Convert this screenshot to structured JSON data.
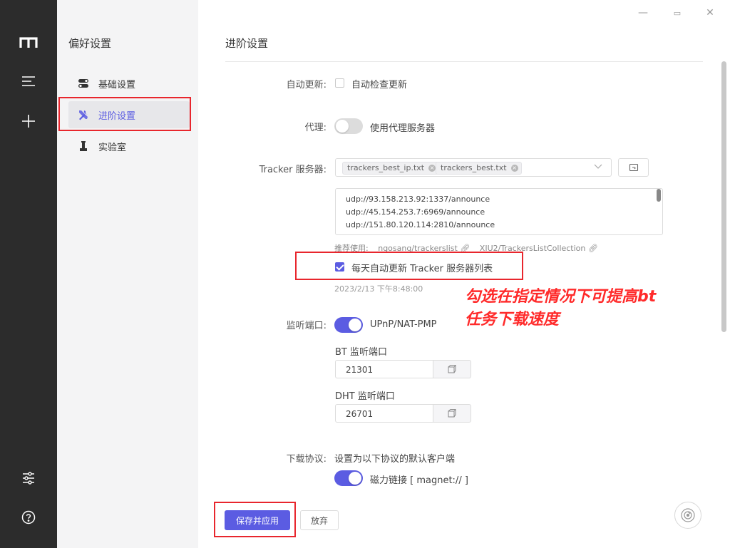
{
  "colors": {
    "accent": "#5b5ce2",
    "rail": "#2c2c2c",
    "sidebar": "#f4f4f5",
    "annotation": "#e8262d"
  },
  "rail": {
    "logo_icon": "motrix-logo-icon",
    "items": [
      "menu-icon",
      "add-icon"
    ],
    "bottom": [
      "settings-sliders-icon",
      "help-icon"
    ]
  },
  "sidebar": {
    "title": "偏好设置",
    "items": [
      {
        "label": "基础设置",
        "icon": "toggle-icon"
      },
      {
        "label": "进阶设置",
        "icon": "tools-icon",
        "active": true
      },
      {
        "label": "实验室",
        "icon": "flask-icon"
      }
    ]
  },
  "main": {
    "title": "进阶设置",
    "auto_update": {
      "label": "自动更新:",
      "option": "自动检查更新",
      "checked": false
    },
    "proxy": {
      "label": "代理:",
      "option": "使用代理服务器",
      "enabled": false
    },
    "tracker": {
      "label": "Tracker 服务器:",
      "tags": [
        "trackers_best_ip.txt",
        "trackers_best.txt"
      ],
      "lines": [
        "udp://93.158.213.92:1337/announce",
        "udp://45.154.253.7:6969/announce",
        "udp://151.80.120.114:2810/announce"
      ],
      "recommend_label": "推荐使用:",
      "recommend_links": [
        "ngosang/trackerslist",
        "XIU2/TrackersListCollection"
      ],
      "auto_update_label": "每天自动更新 Tracker 服务器列表",
      "auto_update_checked": true,
      "last_update": "2023/2/13 下午8:48:00"
    },
    "annotation": {
      "line1": "勾选在指定情况下可提高bt",
      "line2": "任务下载速度"
    },
    "listen_port": {
      "label": "监听端口:",
      "upnp_label": "UPnP/NAT-PMP",
      "upnp_enabled": true,
      "bt_label": "BT 监听端口",
      "bt_value": "21301",
      "dht_label": "DHT 监听端口",
      "dht_value": "26701"
    },
    "protocol": {
      "label": "下载协议:",
      "desc": "设置为以下协议的默认客户端",
      "magnet_label": "磁力链接 [ magnet:// ]",
      "magnet_enabled": true
    },
    "buttons": {
      "save": "保存并应用",
      "discard": "放弃"
    }
  },
  "window_controls": {
    "minimize": "—",
    "maximize": "▭",
    "close": "✕"
  }
}
